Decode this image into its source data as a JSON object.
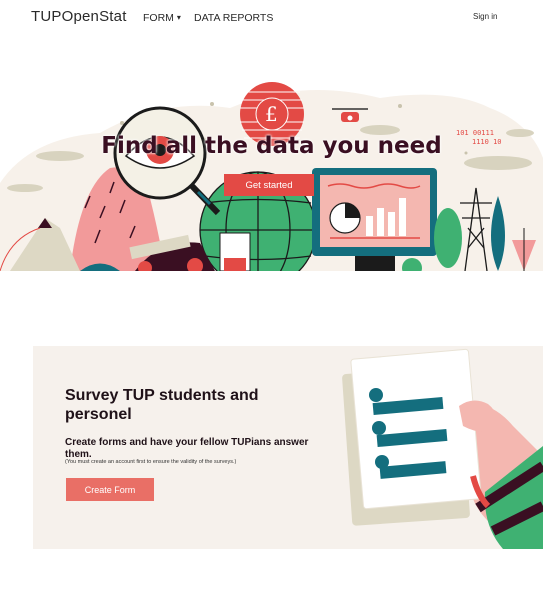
{
  "nav": {
    "brand": "TUPOpenStat",
    "form_label": "FORM",
    "form_caret": "▾",
    "reports_label": "DATA REPORTS",
    "signin_label": "Sign in"
  },
  "hero": {
    "title": "Find all the data you need",
    "cta_label": "Get started",
    "binary_line1": "101 00111",
    "binary_line2": "1110 10",
    "coin_symbol": "£"
  },
  "survey": {
    "title": "Survey TUP students and personel",
    "subtitle": "Create forms and have your fellow TUPians answer them.",
    "note": "(You must create an account first to ensure the validity of the surveys.)",
    "cta_label": "Create Form"
  },
  "colors": {
    "accent_red": "#e34a45",
    "button_salmon": "#e96f66",
    "title_dark": "#3a0f22",
    "teal": "#146e7e",
    "green": "#3fb172",
    "card_bg": "#f6f1ec"
  }
}
